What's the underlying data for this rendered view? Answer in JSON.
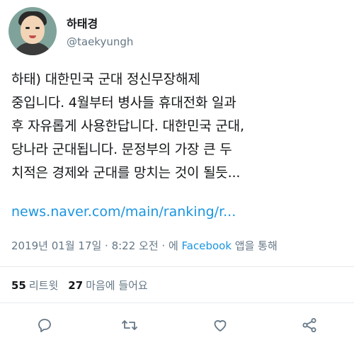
{
  "user": {
    "display_name": "하태경",
    "handle": "@taekyungh"
  },
  "tweet": {
    "lines": [
      "하태) 대한민국 군대 정신무장해제",
      "중입니다. 4월부터 병사들 휴대전화 일과",
      "후 자유롭게 사용한답니다. 대한민국 군대,",
      "당나라 군대됩니다. 문정부의 가장 큰 두",
      "치적은 경제와 군대를 망치는 것이 될듯..."
    ],
    "link": "news.naver.com/main/ranking/r..."
  },
  "meta": {
    "timestamp": "2019년 01월 17일 · 8:22 오전 · 에",
    "source": "Facebook",
    "source_suffix": "앱을 통해"
  },
  "stats": {
    "retweets_count": "55",
    "retweets_label": "리트윗",
    "likes_count": "27",
    "likes_label": "마음에 들어요"
  },
  "actions": {
    "reply_icon": "reply-icon",
    "retweet_icon": "retweet-icon",
    "like_icon": "heart-icon",
    "share_icon": "share-icon"
  },
  "colors": {
    "link": "#1b95e0",
    "secondary": "#657786",
    "text": "#14171a",
    "divider": "#e6ecf0"
  }
}
